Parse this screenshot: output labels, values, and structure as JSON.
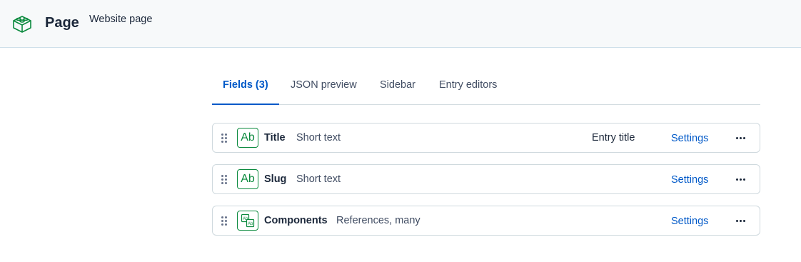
{
  "header": {
    "title": "Page",
    "subtitle": "Website page",
    "icon": "cube-icon"
  },
  "tabs": [
    {
      "label": "Fields (3)",
      "active": true
    },
    {
      "label": "JSON preview",
      "active": false
    },
    {
      "label": "Sidebar",
      "active": false
    },
    {
      "label": "Entry editors",
      "active": false
    }
  ],
  "fields": [
    {
      "name": "Title",
      "type": "Short text",
      "badge": "Entry title",
      "icon": "text-icon",
      "icon_label": "Ab",
      "settings": "Settings"
    },
    {
      "name": "Slug",
      "type": "Short text",
      "badge": "",
      "icon": "text-icon",
      "icon_label": "Ab",
      "settings": "Settings"
    },
    {
      "name": "Components",
      "type": "References, many",
      "badge": "",
      "icon": "references-icon",
      "icon_label": "",
      "settings": "Settings"
    }
  ],
  "colors": {
    "accent": "#0059c8",
    "field_icon": "#0b8a3e",
    "header_bg": "#f7f9fa"
  }
}
